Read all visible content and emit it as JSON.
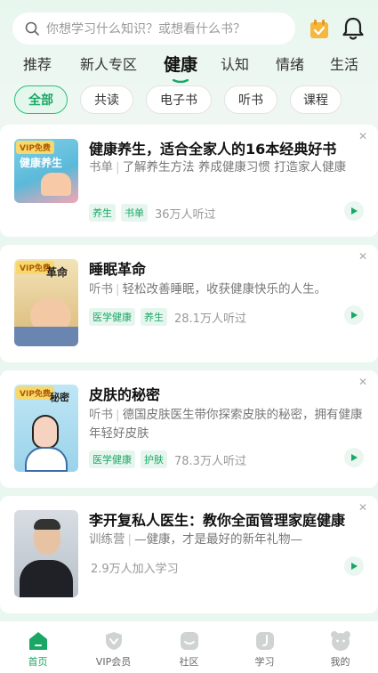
{
  "search": {
    "placeholder": "你想学习什么知识？或想看什么书？"
  },
  "categories": [
    "推荐",
    "新人专区",
    "健康",
    "认知",
    "情绪",
    "生活"
  ],
  "filters": [
    "全部",
    "共读",
    "电子书",
    "听书",
    "课程"
  ],
  "cards": [
    {
      "title": "健康养生，适合全家人的16本经典好书",
      "type": "书单",
      "desc": "了解养生方法 养成健康习惯 打造家人健康",
      "tags": [
        "养生",
        "书单"
      ],
      "count": "36万人听过",
      "badge": "VIP免费",
      "cover_text": "健康养生"
    },
    {
      "title": "睡眠革命",
      "type": "听书",
      "desc": "轻松改善睡眠，收获健康快乐的人生。",
      "tags": [
        "医学健康",
        "养生"
      ],
      "count": "28.1万人听过",
      "badge": "VIP免费",
      "cover_text": "革命"
    },
    {
      "title": "皮肤的秘密",
      "type": "听书",
      "desc": "德国皮肤医生带你探索皮肤的秘密，拥有健康年轻好皮肤",
      "tags": [
        "医学健康",
        "护肤"
      ],
      "count": "78.3万人听过",
      "badge": "VIP免费",
      "cover_text": "秘密"
    },
    {
      "title": "李开复私人医生：教你全面管理家庭健康",
      "type": "训练营",
      "desc": "—健康，才是最好的新年礼物—",
      "tags": [],
      "count": "2.9万人加入学习",
      "badge": "",
      "cover_text": ""
    }
  ],
  "tabs": [
    "首页",
    "VIP会员",
    "社区",
    "学习",
    "我的"
  ],
  "colors": {
    "accent": "#1aa765",
    "background": "#eaf6f0"
  }
}
